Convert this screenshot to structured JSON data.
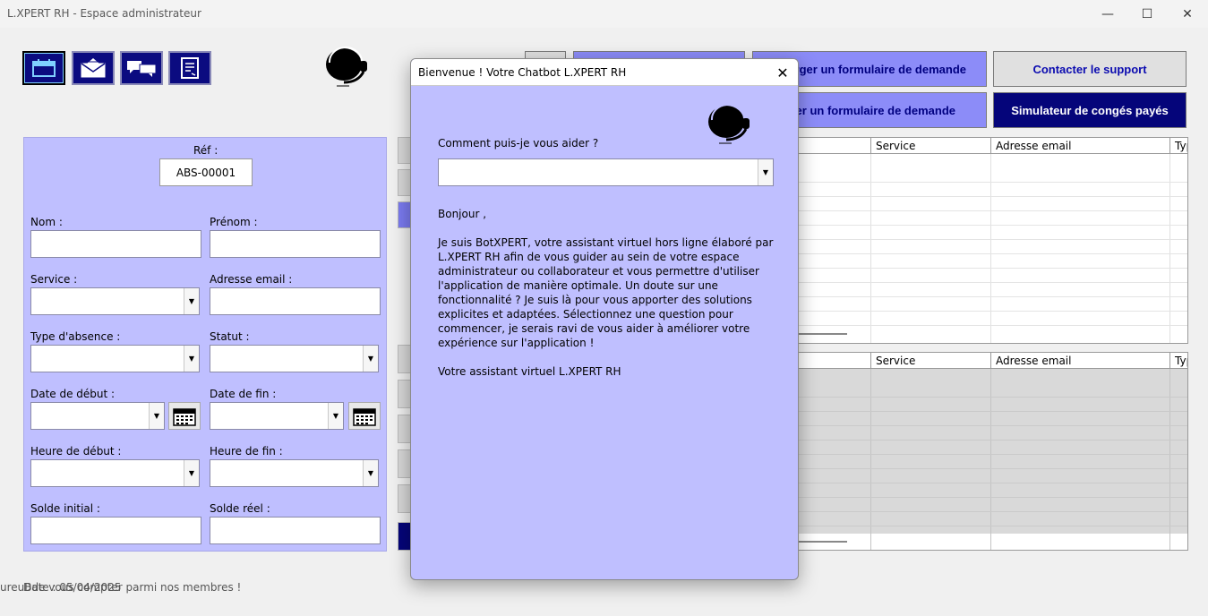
{
  "window": {
    "title": "L.XPERT RH - Espace administrateur",
    "controls": [
      "—",
      "☐",
      "✕"
    ]
  },
  "toolbar": {
    "icons": [
      "calendar-icon",
      "mail-icon",
      "chat-icon",
      "form-icon"
    ]
  },
  "top_buttons": {
    "download_form": "harger un formulaire de demande",
    "contact_support": "Contacter le support",
    "send_form": "oyer un formulaire de demande",
    "leave_simulator": "Simulateur de congés payés"
  },
  "form": {
    "ref_label": "Réf :",
    "ref_value": "ABS-00001",
    "nom_label": "Nom :",
    "prenom_label": "Prénom :",
    "service_label": "Service :",
    "email_label": "Adresse email :",
    "absence_type_label": "Type d'absence :",
    "statut_label": "Statut :",
    "start_date_label": "Date de début :",
    "end_date_label": "Date de fin :",
    "start_time_label": "Heure de début :",
    "end_time_label": "Heure de fin :",
    "initial_balance_label": "Solde initial :",
    "real_balance_label": "Solde réel :"
  },
  "grids": {
    "columns": [
      "Service",
      "Adresse email",
      "Typ"
    ]
  },
  "chatbot": {
    "title": "Bienvenue ! Votre Chatbot L.XPERT RH",
    "close": "✕",
    "question_label": "Comment puis-je vous aider ?",
    "greeting": "Bonjour ,",
    "body": "Je suis BotXPERT, votre assistant virtuel hors ligne élaboré par L.XPERT RH afin de vous guider au sein de votre espace administrateur ou collaborateur et vous permettre d'utiliser l'application de manière optimale. Un doute sur une fonctionnalité ? Je suis là pour vous apporter des solutions explicites et adaptées. Sélectionnez une question pour commencer, je serais ravi de vous aider à améliorer votre expérience sur l'application !",
    "signature": "Votre assistant virtuel L.XPERT RH"
  },
  "status_bar": {
    "welcome": "ureuBde vous compter parmi nos membres !",
    "date": "Date : 05/04/2025"
  }
}
